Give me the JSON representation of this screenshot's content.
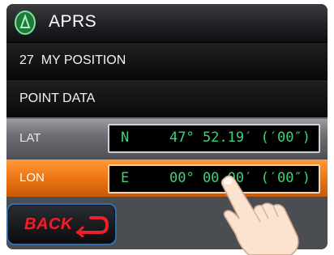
{
  "header": {
    "title": "APRS",
    "logo_icon": "kenwood-circle-logo-icon"
  },
  "rows": {
    "position": {
      "label": "27  MY POSITION"
    },
    "point_data": {
      "label": "POINT DATA"
    },
    "lat": {
      "label": "LAT",
      "hemisphere": "N",
      "value": "47° 52.19′ (′00″)"
    },
    "lon": {
      "label": "LON",
      "hemisphere": "E",
      "value": "00° 00.00′ (′00″)"
    }
  },
  "back_button": {
    "label": "BACK",
    "icon": "return-arrow-icon"
  },
  "colors": {
    "accent_selected": "#f07818",
    "value_text": "#3fd17a",
    "back_text": "#e8212b"
  }
}
